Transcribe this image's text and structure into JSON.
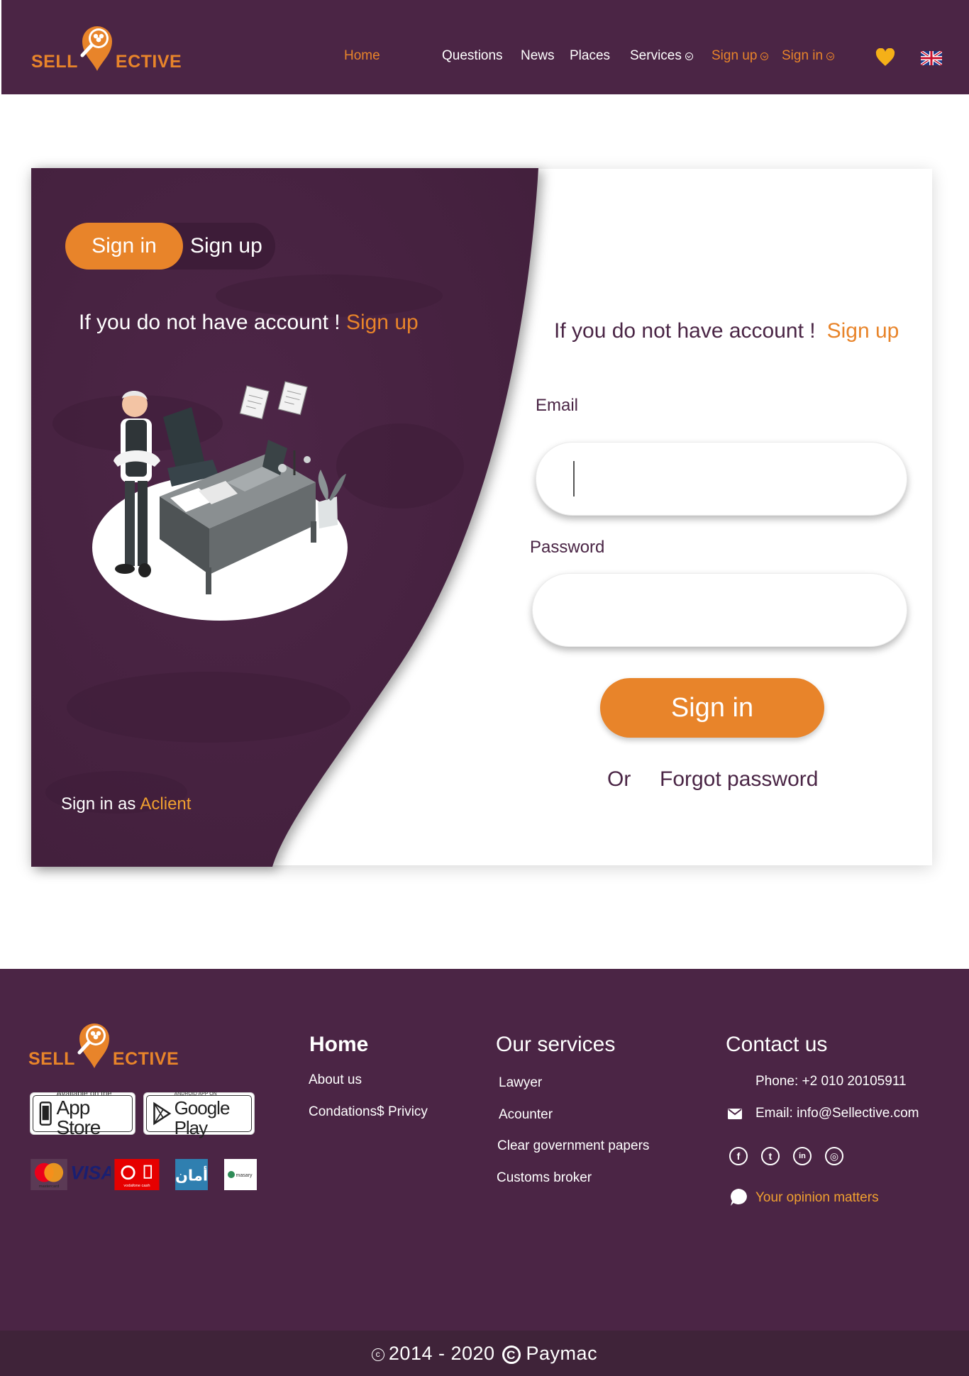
{
  "brand": {
    "word_left": "SELL",
    "word_right": "ECTIVE"
  },
  "nav": {
    "home": "Home",
    "questions": "Questions",
    "news": "News",
    "places": "Places",
    "services": "Services",
    "sign_up": "Sign up",
    "sign_in": "Sign in",
    "favorites_icon": "heart-icon",
    "language_icon": "uk-flag-icon"
  },
  "auth_panel": {
    "toggle_active": "Sign in",
    "toggle_other": "Sign up",
    "prompt": "If you do not have account !",
    "prompt_link": "Sign up",
    "sign_in_as": "Sign in as",
    "sign_in_as_link": "Aclient"
  },
  "form": {
    "prompt": "If you do not have account !",
    "prompt_link": "Sign up",
    "email_label": "Email",
    "email_value": "",
    "password_label": "Password",
    "password_value": "",
    "submit": "Sign in",
    "or": "Or",
    "forgot": "Forgot password"
  },
  "footer": {
    "stores": {
      "app_store_small": "Available on the",
      "app_store_big": "App Store",
      "google_play_small": "ANDROID APP ON",
      "google_play_big": "Google Play"
    },
    "payments": [
      "mastercard",
      "VISA",
      "vodafone cash",
      "أمان",
      "masary"
    ],
    "home_title": "Home",
    "home_links": [
      "About us",
      "Condations$ Privicy"
    ],
    "services_title": "Our services",
    "services_links": [
      "Lawyer",
      "Acounter",
      "Clear government papers",
      "Customs broker"
    ],
    "contact_title": "Contact us",
    "phone": "Phone: +2 010 20105911",
    "email": "Email: info@Sellective.com",
    "social_icons": [
      "facebook-icon",
      "twitter-icon",
      "linkedin-icon",
      "instagram-icon"
    ],
    "opinion": "Your opinion matters",
    "copyright_years": "2014 - 2020",
    "copyright_owner": "Paymac"
  },
  "colors": {
    "brand_purple": "#4b2545",
    "accent_orange": "#e8842a",
    "link_yellow": "#f0a030"
  }
}
